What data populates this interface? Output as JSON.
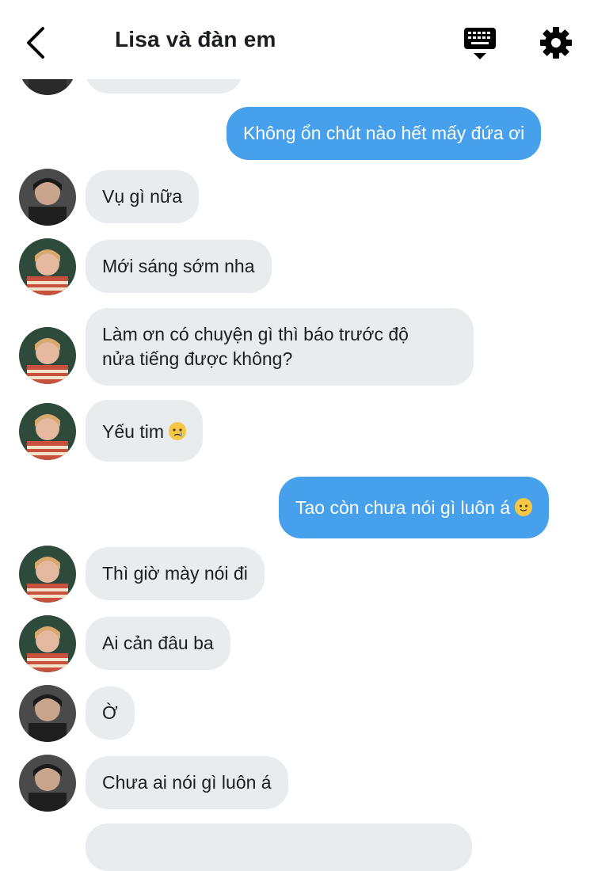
{
  "header": {
    "title": "Lisa và đàn em",
    "back_icon": "chevron-left-icon",
    "keyboard_icon": "keyboard-icon",
    "settings_icon": "gear-icon"
  },
  "colors": {
    "outgoing_bubble": "#47a0ec",
    "incoming_bubble": "#e9ecef",
    "text": "#1c1e21"
  },
  "messages": [
    {
      "from": "other",
      "avatar": "avatar-boy",
      "text": ""
    },
    {
      "from": "me",
      "text": "Không ổn chút nào hết mấy đứa ơi"
    },
    {
      "from": "other",
      "avatar": "avatar-boy",
      "text": "Vụ gì nữa"
    },
    {
      "from": "other",
      "avatar": "avatar-girl",
      "text": "Mới sáng sớm nha"
    },
    {
      "from": "other",
      "avatar": "avatar-girl",
      "text_line1": "Làm ơn có chuyện gì thì báo trước độ",
      "text_line2": "nửa tiếng được không?"
    },
    {
      "from": "other",
      "avatar": "avatar-girl",
      "text": "Yếu tim",
      "emoji": "crying-face-emoji"
    },
    {
      "from": "me",
      "text": "Tao còn chưa nói gì luôn á",
      "emoji": "slightly-smiling-face-emoji"
    },
    {
      "from": "other",
      "avatar": "avatar-girl",
      "text": "Thì giờ mày nói đi"
    },
    {
      "from": "other",
      "avatar": "avatar-girl",
      "text": "Ai cản đâu ba"
    },
    {
      "from": "other",
      "avatar": "avatar-boy",
      "text": "Ờ"
    },
    {
      "from": "other",
      "avatar": "avatar-boy",
      "text": "Chưa ai nói gì luôn á"
    },
    {
      "from": "other",
      "avatar": "",
      "text": ""
    }
  ]
}
